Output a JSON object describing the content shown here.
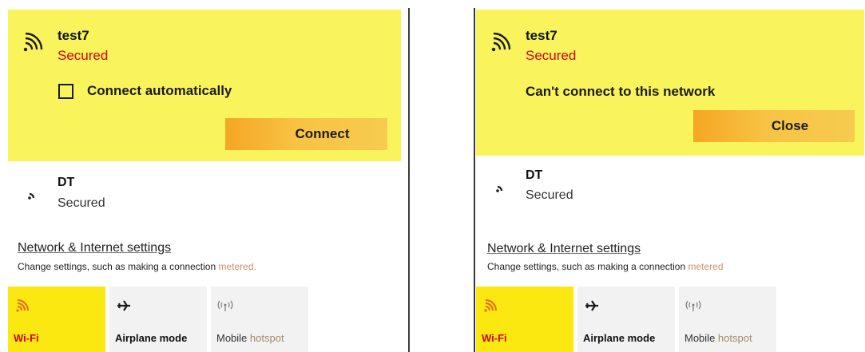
{
  "colors": {
    "selected_bg": "#faf45c",
    "status_red": "#d0021b",
    "button_orange": "#f5a623",
    "tile_active": "#fbe810",
    "tile_inactive": "#f2f2f2"
  },
  "panels": [
    {
      "selected_network": {
        "name": "test7",
        "status": "Secured",
        "checkbox_label": "Connect automatically",
        "checkbox_checked": false,
        "button_label": "Connect"
      },
      "other_network": {
        "name": "DT",
        "status": "Secured"
      },
      "settings": {
        "link": "Network & Internet settings",
        "desc_main": "Change settings, such as making a connection ",
        "desc_tail": "metered."
      },
      "tiles": [
        {
          "label": "Wi-Fi",
          "icon": "wifi-icon",
          "active": true
        },
        {
          "label": "Airplane mode",
          "icon": "airplane-icon",
          "active": false
        },
        {
          "label_main": "Mobile ",
          "label_tail": "hotspot",
          "icon": "hotspot-icon",
          "active": false
        }
      ]
    },
    {
      "selected_network": {
        "name": "test7",
        "status": "Secured",
        "error_message": "Can't connect to this network",
        "button_label": "Close"
      },
      "other_network": {
        "name": "DT",
        "status": "Secured"
      },
      "settings": {
        "link": "Network & Internet settings",
        "desc_main": "Change settings, such as making a connection ",
        "desc_tail": "metered"
      },
      "tiles": [
        {
          "label": "Wi-Fi",
          "icon": "wifi-icon",
          "active": true
        },
        {
          "label": "Airplane mode",
          "icon": "airplane-icon",
          "active": false
        },
        {
          "label_main": "Mobile ",
          "label_tail": "hotspot",
          "icon": "hotspot-icon",
          "active": false
        }
      ]
    }
  ]
}
